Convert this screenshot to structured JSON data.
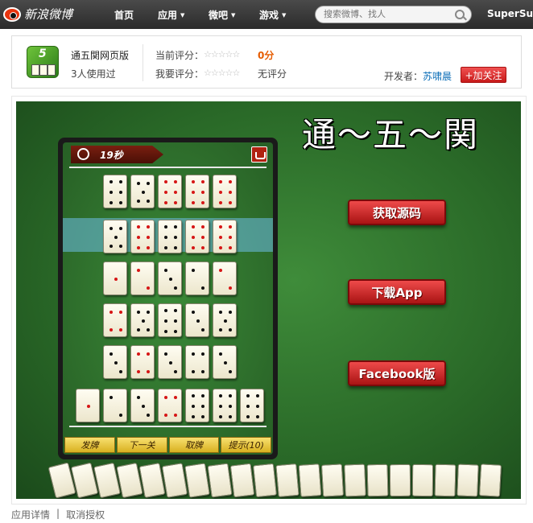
{
  "topnav": {
    "logo_text": "新浪微博",
    "items": [
      {
        "label": "首页",
        "has_caret": false
      },
      {
        "label": "应用",
        "has_caret": true
      },
      {
        "label": "微吧",
        "has_caret": true
      },
      {
        "label": "游戏",
        "has_caret": true
      }
    ],
    "search_placeholder": "搜索微博、找人",
    "search_icon": "search-icon",
    "user_name": "SuperSu..."
  },
  "app": {
    "name": "通五関网页版",
    "users": "3人使用过",
    "icon_number": "5",
    "current_rating_label": "当前评分：",
    "current_score": "0分",
    "my_rating_label": "我要评分：",
    "no_rating": "无评分",
    "stars": "☆☆☆☆☆",
    "developer_label": "开发者：",
    "developer_name": "苏啸晨",
    "follow_label": "+加关注"
  },
  "game": {
    "title_art": "通～五～関",
    "timer": "19秒",
    "buttons": [
      "获取源码",
      "下载App",
      "Facebook版"
    ],
    "panel_buttons": [
      "发牌",
      "下一关",
      "取牌",
      "提示(10)"
    ]
  },
  "footer": {
    "links": [
      "应用详情",
      "取消授权"
    ],
    "separator": "|"
  },
  "colors": {
    "accent_red": "#d61616",
    "link_blue": "#0a6db7",
    "score_orange": "#e65c00",
    "felt_green": "#2a6a28"
  }
}
